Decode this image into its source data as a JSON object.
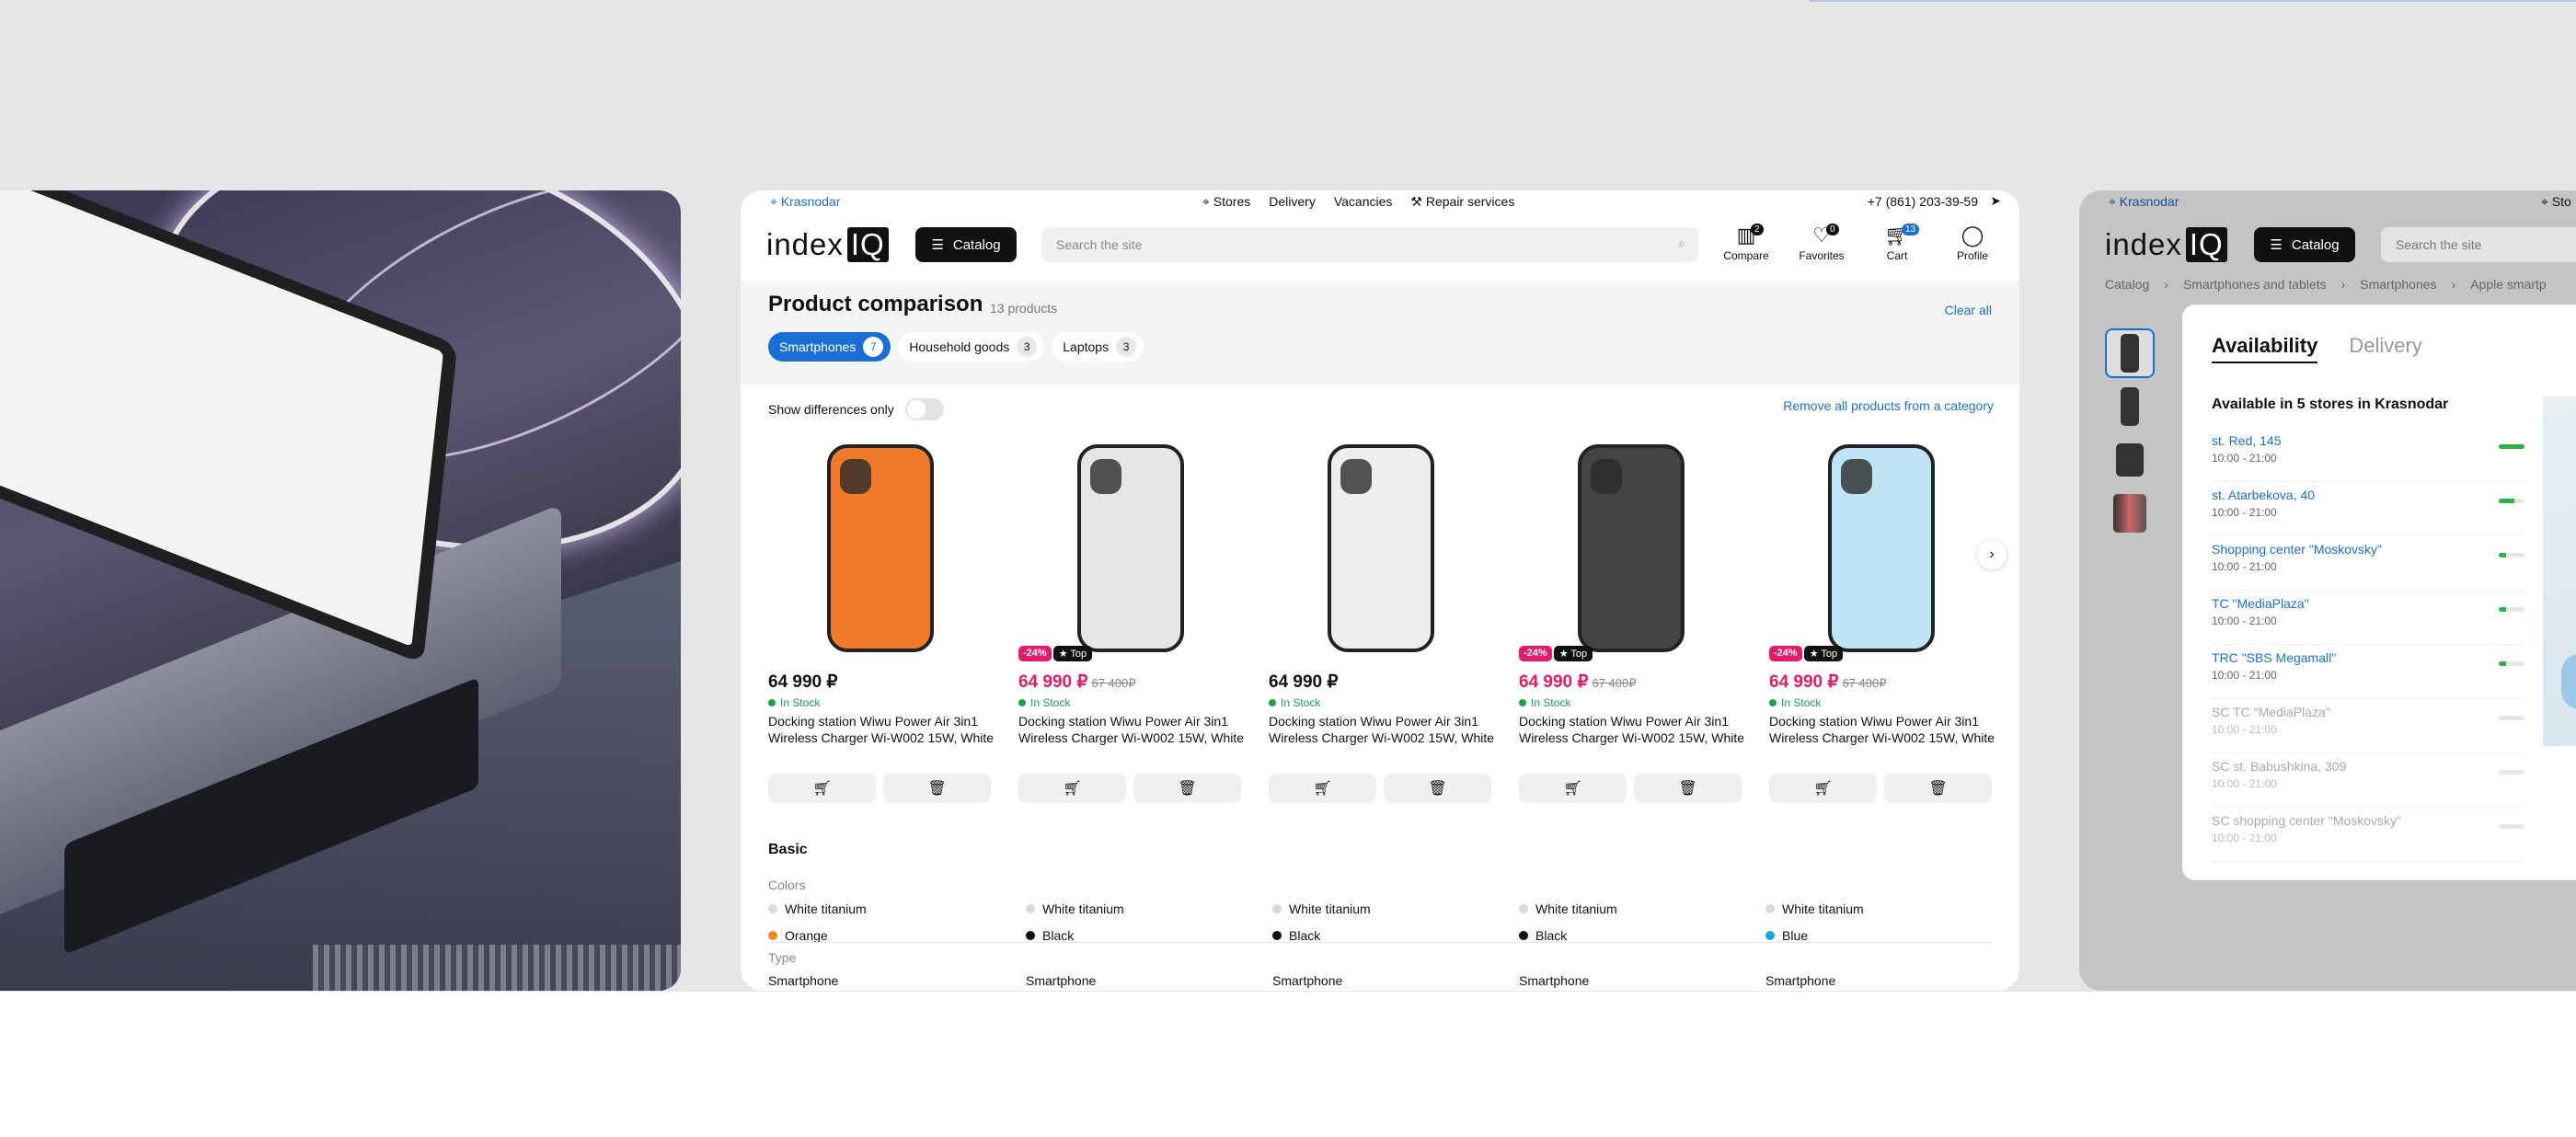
{
  "main": {
    "city": "Krasnodar",
    "util_links": [
      "Stores",
      "Delivery",
      "Vacancies",
      "Repair services"
    ],
    "phone": "+7 (861) 203-39-59",
    "logo_text": "index",
    "logo_iq": "IQ",
    "catalog_label": "Catalog",
    "search_placeholder": "Search the site",
    "header_icons": [
      {
        "label": "Compare",
        "badge": "2",
        "icon": "compare-icon"
      },
      {
        "label": "Favorites",
        "badge": "0",
        "icon": "heart-icon"
      },
      {
        "label": "Cart",
        "badge": "13",
        "icon": "cart-icon"
      },
      {
        "label": "Profile",
        "badge": "",
        "icon": "user-icon"
      }
    ],
    "title": "Product comparison",
    "count": "13 products",
    "clear_all": "Clear all",
    "categories": [
      {
        "label": "Smartphones",
        "count": "7"
      },
      {
        "label": "Household goods",
        "count": "3"
      },
      {
        "label": "Laptops",
        "count": "3"
      }
    ],
    "show_diff": "Show differences only",
    "remove_category": "Remove all products from a category",
    "products": [
      {
        "price": "64 990 ₽",
        "old": "",
        "discount": "",
        "top": "",
        "stock": "In Stock",
        "name": "Docking station Wiwu Power Air 3in1 Wireless Charger Wi-W002 15W, White",
        "color": "#f07a2a"
      },
      {
        "price": "64 990 ₽",
        "old": "67 400₽",
        "discount": "-24%",
        "top": "★ Top",
        "stock": "In Stock",
        "name": "Docking station Wiwu Power Air 3in1 Wireless Charger Wi-W002 15W, White",
        "color": "#e6e6e6"
      },
      {
        "price": "64 990 ₽",
        "old": "",
        "discount": "",
        "top": "",
        "stock": "In Stock",
        "name": "Docking station Wiwu Power Air 3in1 Wireless Charger Wi-W002 15W, White",
        "color": "#eeeeee"
      },
      {
        "price": "64 990 ₽",
        "old": "67 400₽",
        "discount": "-24%",
        "top": "★ Top",
        "stock": "In Stock",
        "name": "Docking station Wiwu Power Air 3in1 Wireless Charger Wi-W002 15W, White",
        "color": "#444444"
      },
      {
        "price": "64 990 ₽",
        "old": "67 400₽",
        "discount": "-24%",
        "top": "★ Top",
        "stock": "In Stock",
        "name": "Docking station Wiwu Power Air 3in1 Wireless Charger Wi-W002 15W, White",
        "color": "#bfe4f5"
      }
    ],
    "section_basic": "Basic",
    "label_colors": "Colors",
    "colors_row1": [
      "White titanium",
      "White titanium",
      "White titanium",
      "White titanium",
      "White titanium"
    ],
    "colors_row2": [
      {
        "name": "Orange",
        "hex": "#f08a1e"
      },
      {
        "name": "Black",
        "hex": "#111111"
      },
      {
        "name": "Black",
        "hex": "#111111"
      },
      {
        "name": "Black",
        "hex": "#111111"
      },
      {
        "name": "Blue",
        "hex": "#1aa3e8"
      }
    ],
    "label_type": "Type",
    "type_row": [
      "Smartphone",
      "Smartphone",
      "Smartphone",
      "Smartphone",
      "Smartphone"
    ]
  },
  "right": {
    "city": "Krasnodar",
    "store": "Sto",
    "logo_text": "index",
    "logo_iq": "IQ",
    "catalog_label": "Catalog",
    "search_placeholder": "Search the site",
    "breadcrumbs": [
      "Catalog",
      "Smartphones and tablets",
      "Smartphones",
      "Apple smartp"
    ],
    "tab_availability": "Availability",
    "tab_delivery": "Delivery",
    "available_title": "Available in 5 stores in Krasnodar",
    "stores": [
      {
        "name": "st. Red, 145",
        "hours": "10:00 - 21:00",
        "level": 1.0,
        "dim": false
      },
      {
        "name": "st. Atarbekova, 40",
        "hours": "10:00 - 21:00",
        "level": 0.6,
        "dim": false
      },
      {
        "name": "Shopping center \"Moskovsky\"",
        "hours": "10:00 - 21:00",
        "level": 0.3,
        "dim": false
      },
      {
        "name": "TC \"MediaPlaza\"",
        "hours": "10:00 - 21:00",
        "level": 0.3,
        "dim": false
      },
      {
        "name": "TRC \"SBS Megamall\"",
        "hours": "10:00 - 21:00",
        "level": 0.3,
        "dim": false
      },
      {
        "name": "SC TC \"MediaPlaza\"",
        "hours": "10:00 - 21:00",
        "level": 0,
        "dim": true
      },
      {
        "name": "SC st. Babushkina, 309",
        "hours": "10:00 - 21:00",
        "level": 0,
        "dim": true
      },
      {
        "name": "SC shopping center \"Moskovsky\"",
        "hours": "10:00 - 21:00",
        "level": 0,
        "dim": true
      }
    ]
  }
}
